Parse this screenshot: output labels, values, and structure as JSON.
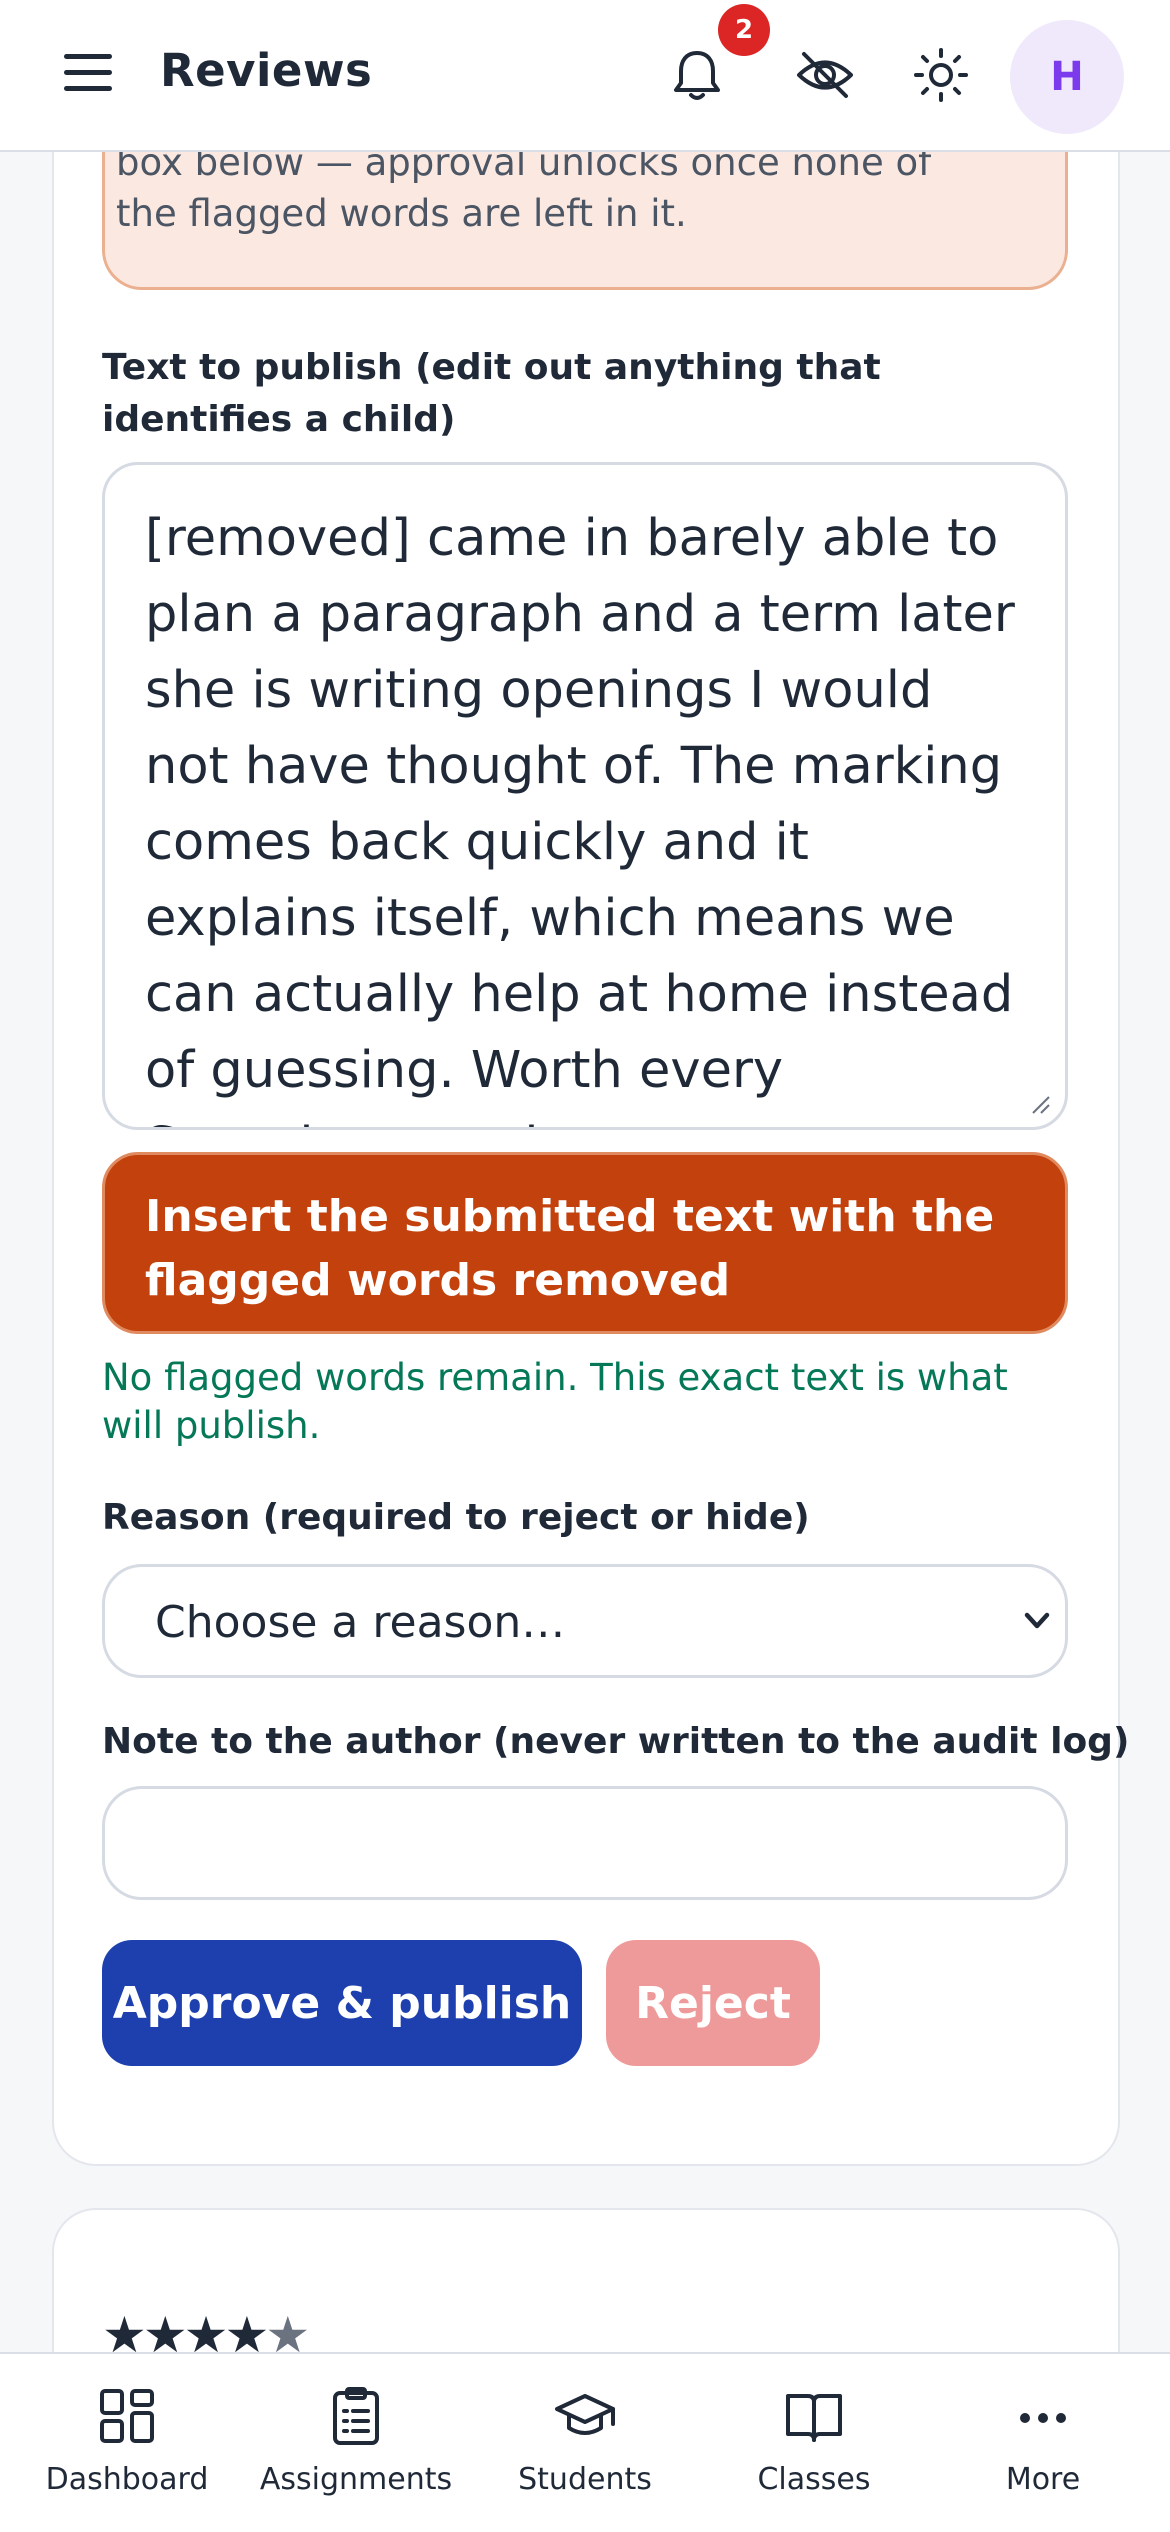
{
  "header": {
    "title": "Reviews",
    "notification_count": "2",
    "avatar_initial": "H"
  },
  "warning": {
    "text": "version that should appear publicly in the box below — approval unlocks once none of the flagged words are left in it."
  },
  "form": {
    "text_label": "Text to publish (edit out anything that identifies a child)",
    "text_value": "[removed] came in barely able to plan a paragraph and a term later she is writing openings I would not have thought of. The marking comes back quickly and it explains itself, which means we can actually help at home instead of guessing. Worth every Saturday morning.",
    "insert_button": "Insert the submitted text with the flagged words removed",
    "status_message": "No flagged words remain. This exact text is what will publish.",
    "reason_label": "Reason (required to reject or hide)",
    "reason_selected": "Choose a reason…",
    "note_label": "Note to the author (never written to the audit log)",
    "note_value": "",
    "approve_button": "Approve & publish",
    "reject_button": "Reject"
  },
  "next_review": {
    "rating": 4
  },
  "bottom_nav": {
    "items": [
      {
        "label": "Dashboard",
        "icon": "dashboard-icon"
      },
      {
        "label": "Assignments",
        "icon": "clipboard-icon"
      },
      {
        "label": "Students",
        "icon": "graduation-cap-icon"
      },
      {
        "label": "Classes",
        "icon": "book-icon"
      },
      {
        "label": "More",
        "icon": "more-icon"
      }
    ]
  },
  "colors": {
    "accent_blue": "#1e40af",
    "insert_orange": "#c2410c",
    "success_green": "#047857",
    "badge_red": "#dc2626",
    "reject_disabled": "#ef9a9a"
  }
}
